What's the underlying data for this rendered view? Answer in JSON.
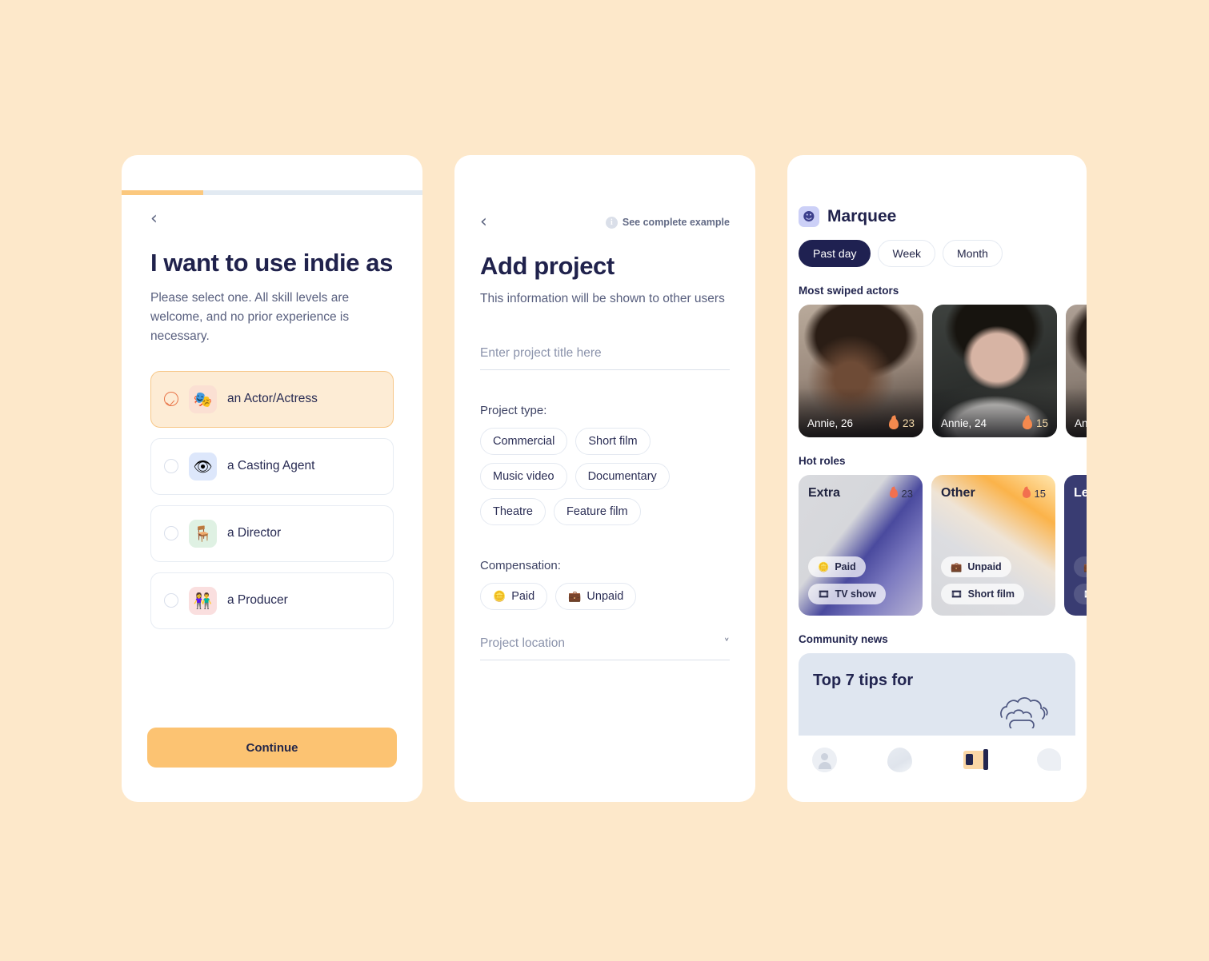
{
  "background_color": "#fde8ca",
  "onboarding": {
    "progress_percent": 27,
    "back_icon": "chevron-left-icon",
    "title": "I want to use indie as",
    "subtitle": "Please select one. All skill levels are welcome, and no prior experience is necessary.",
    "options": [
      {
        "label": "an Actor/Actress",
        "emoji": "🎭",
        "icon_name": "theater-masks-icon",
        "selected": true
      },
      {
        "label": "a Casting Agent",
        "emoji": "👁",
        "icon_name": "eye-icon",
        "selected": false
      },
      {
        "label": "a Director",
        "emoji": "🪑",
        "icon_name": "directors-chair-icon",
        "selected": false
      },
      {
        "label": "a Producer",
        "emoji": "👫",
        "icon_name": "people-icon",
        "selected": false
      }
    ],
    "continue_label": "Continue"
  },
  "add_project": {
    "back_icon": "chevron-left-icon",
    "see_example_label": "See complete example",
    "info_icon_glyph": "i",
    "title": "Add project",
    "subtitle": "This information will be shown to other users",
    "project_title_value": "",
    "project_title_placeholder": "Enter project title here",
    "project_type_label": "Project type:",
    "project_types": [
      "Commercial",
      "Short film",
      "Music video",
      "Documentary",
      "Theatre",
      "Feature film"
    ],
    "compensation_label": "Compensation:",
    "compensation_options": [
      {
        "label": "Paid",
        "emoji": "🪙",
        "icon_name": "coin-icon"
      },
      {
        "label": "Unpaid",
        "emoji": "💼",
        "icon_name": "briefcase-icon"
      }
    ],
    "location_placeholder": "Project location",
    "location_chevron": "chevron-down-icon"
  },
  "marquee": {
    "brand_name": "Marquee",
    "brand_emoji": "☻",
    "brand_icon_name": "theater-mask-icon",
    "time_tabs": [
      {
        "label": "Past day",
        "active": true
      },
      {
        "label": "Week",
        "active": false
      },
      {
        "label": "Month",
        "active": false
      }
    ],
    "actors_heading": "Most swiped actors",
    "actors": [
      {
        "name": "Annie, 26",
        "heat": "23"
      },
      {
        "name": "Annie, 24",
        "heat": "15"
      },
      {
        "name": "Ann",
        "heat": ""
      }
    ],
    "roles_heading": "Hot roles",
    "roles": [
      {
        "title": "Extra",
        "heat": "23",
        "tags": [
          {
            "label": "Paid",
            "emoji": "🪙"
          },
          {
            "label": "TV show",
            "emoji": "🎞"
          }
        ]
      },
      {
        "title": "Other",
        "heat": "15",
        "tags": [
          {
            "label": "Unpaid",
            "emoji": "💼"
          },
          {
            "label": "Short film",
            "emoji": "🎞"
          }
        ]
      },
      {
        "title": "Lea",
        "heat": "",
        "tags": [
          {
            "label": "",
            "emoji": "💼"
          },
          {
            "label": "",
            "emoji": "🎞"
          }
        ]
      }
    ],
    "news_heading": "Community news",
    "news_title": "Top 7 tips for",
    "nav_items": [
      {
        "icon_name": "person-icon",
        "active": false
      },
      {
        "icon_name": "blob-icon",
        "active": false
      },
      {
        "icon_name": "newspaper-icon",
        "active": true
      },
      {
        "icon_name": "chat-bubble-icon",
        "active": false
      }
    ]
  }
}
